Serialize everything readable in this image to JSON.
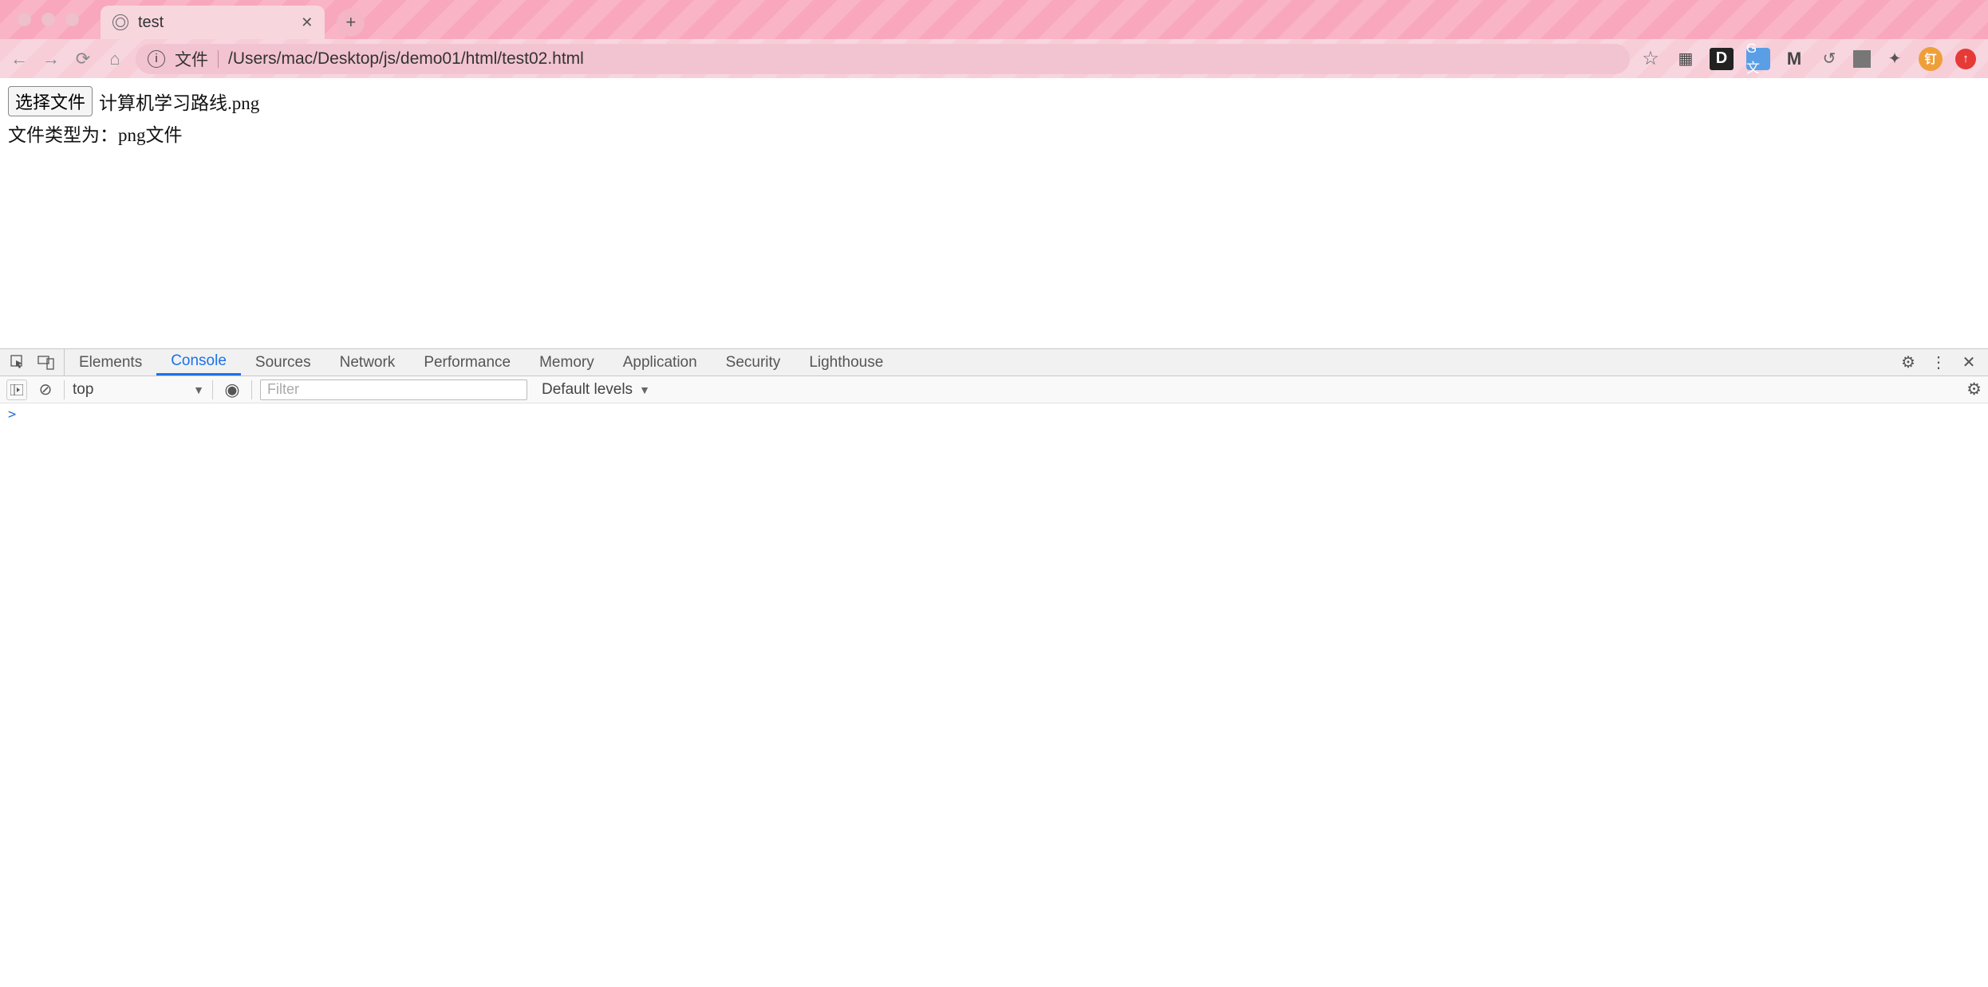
{
  "window": {
    "tab_title": "test",
    "url_scheme": "文件",
    "url_path": "/Users/mac/Desktop/js/demo01/html/test02.html"
  },
  "page": {
    "choose_file_label": "选择文件",
    "selected_file_name": "计算机学习路线.png",
    "file_type_text": "文件类型为：png文件"
  },
  "devtools": {
    "tabs": {
      "elements": "Elements",
      "console": "Console",
      "sources": "Sources",
      "network": "Network",
      "performance": "Performance",
      "memory": "Memory",
      "application": "Application",
      "security": "Security",
      "lighthouse": "Lighthouse"
    },
    "active_tab": "Console",
    "context": "top",
    "filter_placeholder": "Filter",
    "levels_label": "Default levels",
    "prompt": ">"
  },
  "toolbar": {
    "avatar_text": "钉"
  }
}
